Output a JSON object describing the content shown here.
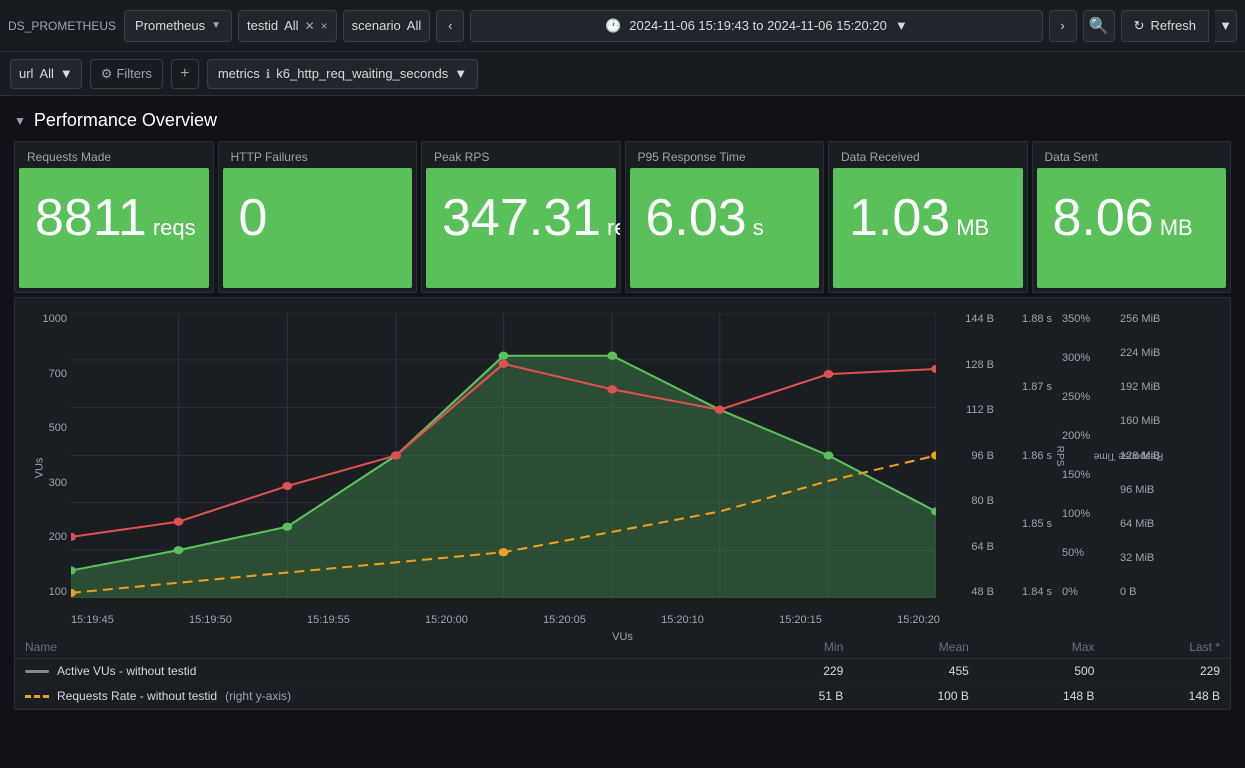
{
  "topbar": {
    "ds_label": "DS_PROMETHEUS",
    "datasource": "Prometheus",
    "testid_label": "testid",
    "testid_all": "All",
    "scenario_label": "scenario",
    "scenario_all": "All",
    "time_range": "2024-11-06 15:19:43 to 2024-11-06 15:20:20",
    "refresh_label": "Refresh"
  },
  "filterbar": {
    "url_label": "url",
    "url_all": "All",
    "filters_label": "Filters",
    "metrics_label": "metrics",
    "metrics_value": "k6_http_req_waiting_seconds"
  },
  "section": {
    "title": "Performance Overview",
    "collapse_icon": "▼"
  },
  "stat_cards": [
    {
      "label": "Requests Made",
      "value": "8811",
      "unit": "reqs"
    },
    {
      "label": "HTTP Failures",
      "value": "0",
      "unit": ""
    },
    {
      "label": "Peak RPS",
      "value": "347.31",
      "unit": "req/s"
    },
    {
      "label": "P95 Response Time",
      "value": "6.03",
      "unit": "s"
    },
    {
      "label": "Data Received",
      "value": "1.03",
      "unit": "MB"
    },
    {
      "label": "Data Sent",
      "value": "8.06",
      "unit": "MB"
    }
  ],
  "chart": {
    "x_labels": [
      "15:19:45",
      "15:19:50",
      "15:19:55",
      "15:20:00",
      "15:20:05",
      "15:20:10",
      "15:20:15",
      "15:20:20"
    ],
    "x_axis_label": "VUs",
    "y_left_labels": [
      "1000",
      "700",
      "500",
      "300",
      "200",
      "100"
    ],
    "y_left_label": "VUs",
    "y_right_rps_labels": [
      "1.88 s",
      "1.87 s",
      "1.86 s",
      "1.85 s",
      "1.84 s"
    ],
    "y_right_rps_label": "RPS",
    "y_right_resp_labels": [
      "350%",
      "300%",
      "250%",
      "200%",
      "150%",
      "100%",
      "50%",
      "0%"
    ],
    "y_right_resp_label": "Response Time",
    "y_right_data_labels": [
      "256 MiB",
      "224 MiB",
      "192 MiB",
      "160 MiB",
      "128 MiB",
      "96 MiB",
      "64 MiB",
      "32 MiB",
      "0 B"
    ],
    "y_right_bytes_labels": [
      "144 B",
      "128 B",
      "112 B",
      "96 B",
      "80 B",
      "64 B",
      "48 B"
    ]
  },
  "legend": {
    "columns": [
      "Name",
      "Min",
      "Mean",
      "Max",
      "Last *"
    ],
    "rows": [
      {
        "name": "Active VUs - without testid",
        "line_type": "solid_gray",
        "min": "229",
        "mean": "455",
        "max": "500",
        "last": "229"
      },
      {
        "name": "Requests Rate - without testid",
        "name_suffix": "(right y-axis)",
        "line_type": "dashed_orange",
        "min": "51 B",
        "mean": "100 B",
        "max": "148 B",
        "last": "148 B"
      }
    ]
  }
}
